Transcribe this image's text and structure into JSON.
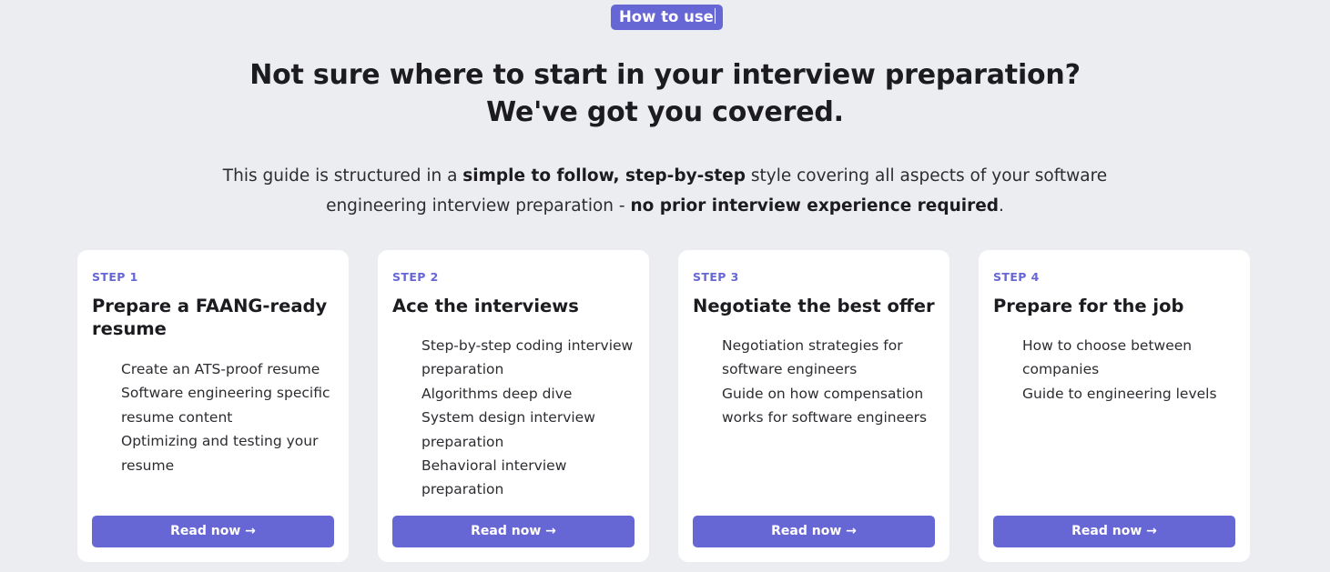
{
  "badge": {
    "label": "How to use"
  },
  "headline": {
    "line1": "Not sure where to start in your interview preparation?",
    "line2": "We've got you covered."
  },
  "subtitle": {
    "part1": "This guide is structured in a ",
    "bold1": "simple to follow, step-by-step",
    "part2": " style covering all aspects of your software engineering interview preparation - ",
    "bold2": "no prior interview experience required",
    "part3": "."
  },
  "cards": [
    {
      "step": "STEP 1",
      "title": "Prepare a FAANG-ready resume",
      "items": [
        "Create an ATS-proof resume",
        "Software engineering specific resume content",
        "Optimizing and testing your resume"
      ],
      "button": "Read now →"
    },
    {
      "step": "STEP 2",
      "title": "Ace the interviews",
      "items": [
        "Step-by-step coding interview preparation",
        "Algorithms deep dive",
        "System design interview preparation",
        "Behavioral interview preparation"
      ],
      "button": "Read now →"
    },
    {
      "step": "STEP 3",
      "title": "Negotiate the best offer",
      "items": [
        "Negotiation strategies for software engineers",
        "Guide on how compensation works for software engineers"
      ],
      "button": "Read now →"
    },
    {
      "step": "STEP 4",
      "title": "Prepare for the job",
      "items": [
        "How to choose between companies",
        "Guide to engineering levels"
      ],
      "button": "Read now →"
    }
  ]
}
